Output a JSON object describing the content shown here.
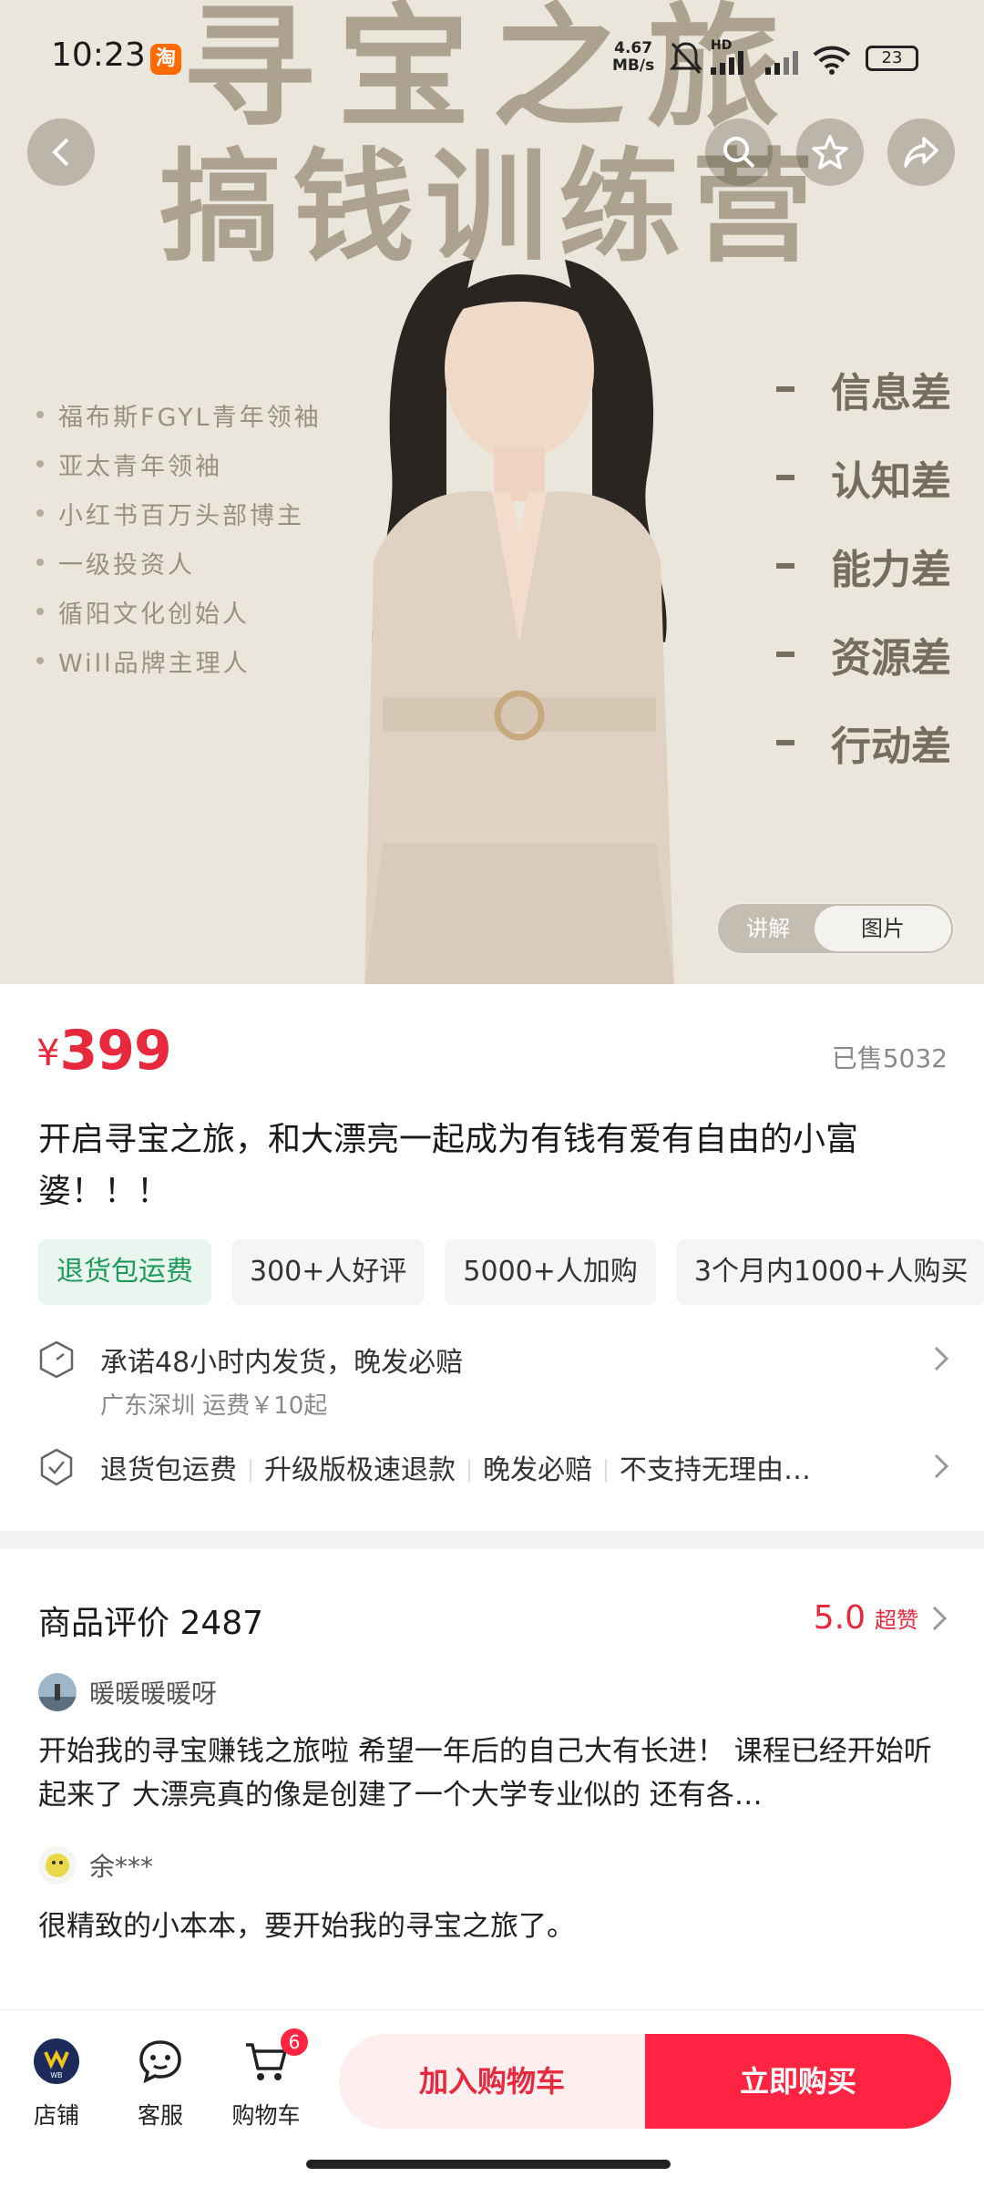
{
  "status_bar": {
    "time": "10:23",
    "app_badge": "淘",
    "net_speed_value": "4.67",
    "net_speed_unit": "MB/s",
    "hd_label": "HD",
    "battery": "23"
  },
  "hero": {
    "title_line1": "寻宝之旅",
    "title_line2": "搞钱训练营",
    "credentials": [
      "福布斯FGYL青年领袖",
      "亚太青年领袖",
      "小红书百万头部博主",
      "一级投资人",
      "循阳文化创始人",
      "Will品牌主理人"
    ],
    "gaps": [
      "信息差",
      "认知差",
      "能力差",
      "资源差",
      "行动差"
    ],
    "switch_explain": "讲解",
    "switch_image": "图片"
  },
  "product": {
    "currency": "¥",
    "price": "399",
    "sold": "已售5032",
    "title": "开启寻宝之旅，和大漂亮一起成为有钱有爱有自由的小富婆！！！",
    "tags": [
      "退货包运费",
      "300+人好评",
      "5000+人加购",
      "3个月内1000+人购买"
    ]
  },
  "service": {
    "shipping": "承诺48小时内发货，晚发必赔",
    "origin": "广东深圳 运费￥10起",
    "guarantees": [
      "退货包运费",
      "升级版极速退款",
      "晚发必赔",
      "不支持无理由…"
    ]
  },
  "reviews": {
    "heading": "商品评价 2487",
    "score": "5.0",
    "score_label": "超赞",
    "items": [
      {
        "user": "暖暖暖暖呀",
        "text": "开始我的寻宝赚钱之旅啦 希望一年后的自己大有长进！ 课程已经开始听起来了 大漂亮真的像是创建了一个大学专业似的 还有各…"
      },
      {
        "user": "余***",
        "text": "很精致的小本本，要开始我的寻宝之旅了。"
      }
    ]
  },
  "bottom_bar": {
    "store": "店铺",
    "service": "客服",
    "cart": "购物车",
    "cart_count": "6",
    "add_to_cart": "加入购物车",
    "buy_now": "立即购买"
  },
  "colors": {
    "accent_red": "#ff2442",
    "price_red": "#e8283c",
    "green_tag": "#1d9a5a",
    "hero_bg": "#ebe6dc"
  }
}
